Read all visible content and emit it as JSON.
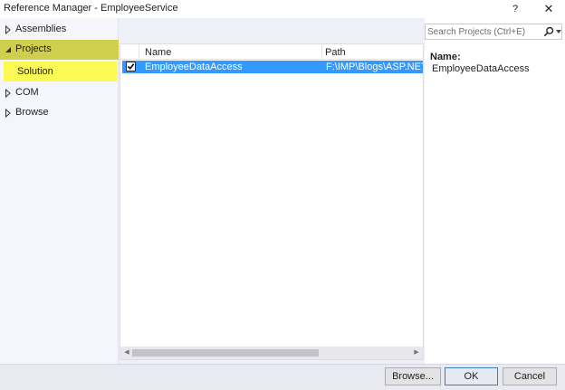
{
  "window": {
    "title": "Reference Manager - EmployeeService",
    "help_glyph": "?",
    "close_glyph": "✕"
  },
  "tree": {
    "items": [
      {
        "label": "Assemblies",
        "expanded": false
      },
      {
        "label": "Projects",
        "expanded": true,
        "selected": true
      },
      {
        "label": "COM",
        "expanded": false
      },
      {
        "label": "Browse",
        "expanded": false
      }
    ],
    "sub_items": [
      {
        "label": "Solution",
        "highlighted": true
      }
    ]
  },
  "grid": {
    "columns": [
      "Name",
      "Path"
    ],
    "rows": [
      {
        "checked": true,
        "name": "EmployeeDataAccess",
        "path": "F:\\IMP\\Blogs\\ASP.NET We"
      }
    ]
  },
  "search": {
    "placeholder": "Search Projects (Ctrl+E)"
  },
  "details": {
    "name_label": "Name:",
    "name_value": "EmployeeDataAccess"
  },
  "buttons": {
    "browse": "Browse...",
    "ok": "OK",
    "cancel": "Cancel"
  },
  "colors": {
    "selection": "#3399ff",
    "projects_highlight": "#cfcf4d",
    "solution_highlight": "#fbfa55"
  }
}
